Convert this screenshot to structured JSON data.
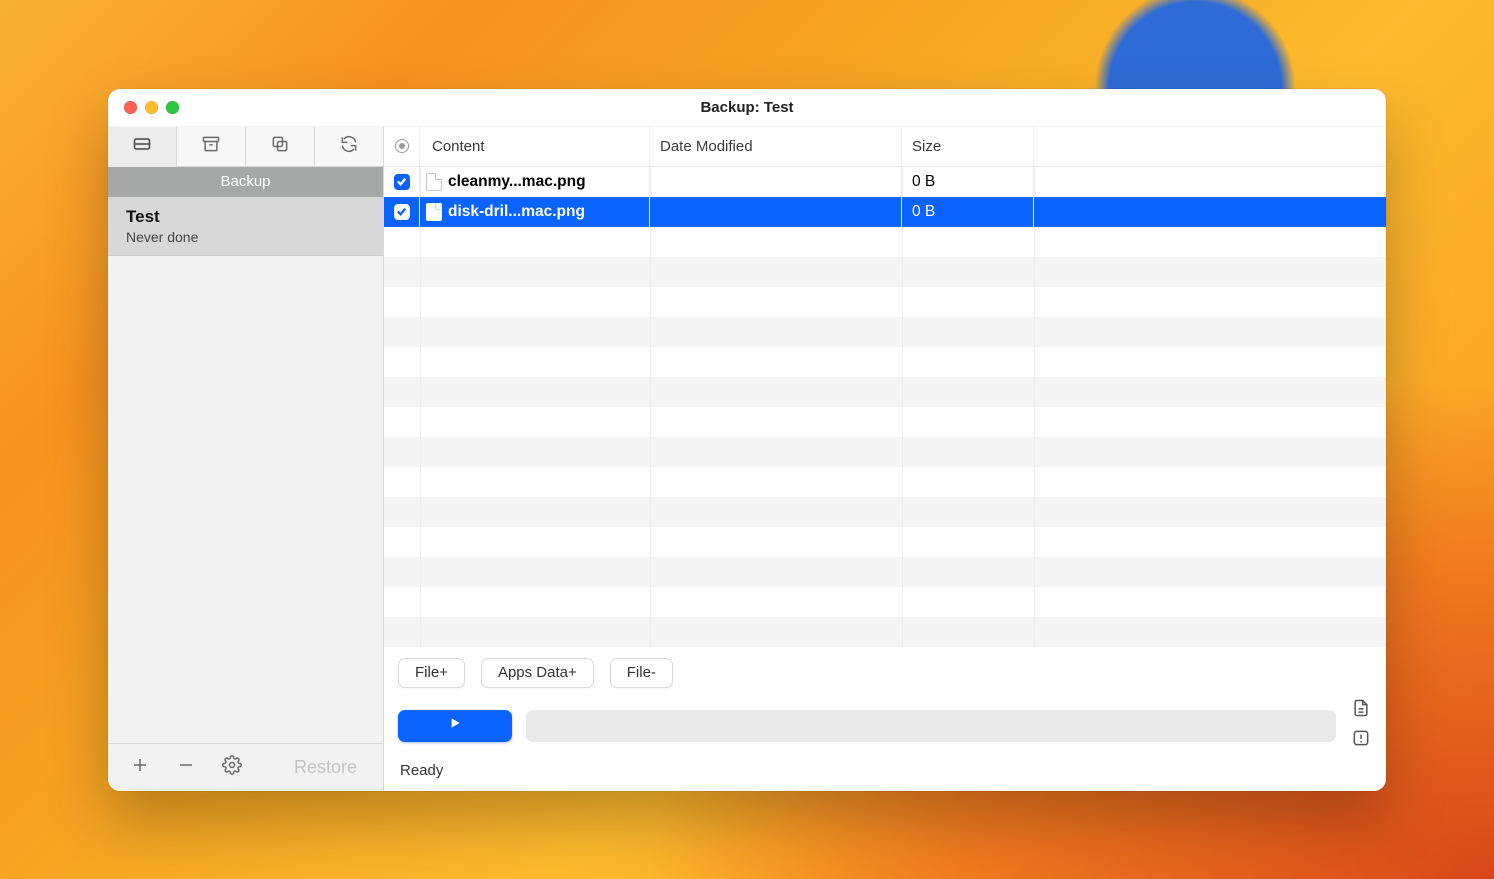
{
  "window": {
    "title": "Backup: Test"
  },
  "sidebar": {
    "header": "Backup",
    "items": [
      {
        "name": "Test",
        "subtitle": "Never done"
      }
    ],
    "restore_label": "Restore"
  },
  "table": {
    "headers": {
      "content": "Content",
      "date": "Date Modified",
      "size": "Size"
    },
    "rows": [
      {
        "checked": true,
        "selected": false,
        "name": "cleanmy...mac.png",
        "date": "",
        "size": "0 B"
      },
      {
        "checked": true,
        "selected": true,
        "name": "disk-dril...mac.png",
        "date": "",
        "size": "0 B"
      }
    ]
  },
  "actions": {
    "file_add": "File+",
    "apps_data": "Apps Data+",
    "file_remove": "File-"
  },
  "status": {
    "text": "Ready"
  }
}
